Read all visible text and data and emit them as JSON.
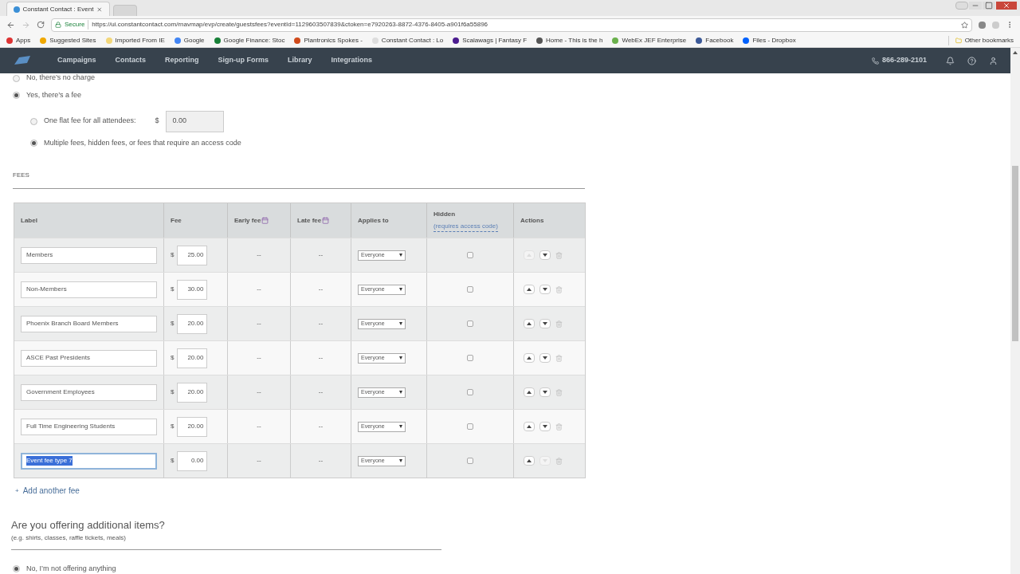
{
  "browser": {
    "tabs": [
      {
        "title": "Constant Contact : Event",
        "selected": true
      },
      {
        "selected": false
      }
    ],
    "url_secure": "Secure",
    "url": "https://ui.constantcontact.com/rnavmap/evp/create/guestsfees?eventId=1129603507839&ctoken=e7920263-8872-4376-8405-a901f6a55896",
    "bookmarks": [
      "Apps",
      "Suggested Sites",
      "Imported From IE",
      "Google",
      "Google Finance: Stoc",
      "Plantronics Spokes -",
      "Constant Contact : Lo",
      "Scalawags | Fantasy F",
      "Home - This is the h",
      "WebEx JEF Enterprise",
      "Facebook",
      "Files - Dropbox"
    ],
    "other_bookmarks": "Other bookmarks"
  },
  "nav": {
    "items": [
      "Campaigns",
      "Contacts",
      "Reporting",
      "Sign-up Forms",
      "Library",
      "Integrations"
    ],
    "phone": "866-289-2101"
  },
  "charge_options": [
    {
      "label": "No, there’s no charge",
      "selected": false
    },
    {
      "label": "Yes, there’s a fee",
      "selected": true
    }
  ],
  "fee_options": [
    {
      "label": "One flat fee for all attendees:",
      "selected": false,
      "currency": "$",
      "value": "0.00"
    },
    {
      "label": "Multiple fees, hidden fees, or fees that require an access code",
      "selected": true
    }
  ],
  "fees_heading": "FEES",
  "columns": {
    "label": "Label",
    "fee": "Fee",
    "early_fee": "Early fee",
    "late_fee": "Late fee",
    "applies_to": "Applies to",
    "hidden": "Hidden",
    "hidden_note": "(requires access code)",
    "actions": "Actions"
  },
  "rows": [
    {
      "label": "Members",
      "currency": "$",
      "fee": "25.00",
      "early": "--",
      "late": "--",
      "applies": "Everyone",
      "hidden": false,
      "up_disabled": true,
      "down_disabled": false,
      "focused": false
    },
    {
      "label": "Non-Members",
      "currency": "$",
      "fee": "30.00",
      "early": "--",
      "late": "--",
      "applies": "Everyone",
      "hidden": false,
      "up_disabled": false,
      "down_disabled": false,
      "focused": false
    },
    {
      "label": "Phoenix Branch Board Members",
      "currency": "$",
      "fee": "20.00",
      "early": "--",
      "late": "--",
      "applies": "Everyone",
      "hidden": false,
      "up_disabled": false,
      "down_disabled": false,
      "focused": false
    },
    {
      "label": "ASCE Past Presidents",
      "currency": "$",
      "fee": "20.00",
      "early": "--",
      "late": "--",
      "applies": "Everyone",
      "hidden": false,
      "up_disabled": false,
      "down_disabled": false,
      "focused": false
    },
    {
      "label": "Government Employees",
      "currency": "$",
      "fee": "20.00",
      "early": "--",
      "late": "--",
      "applies": "Everyone",
      "hidden": false,
      "up_disabled": false,
      "down_disabled": false,
      "focused": false
    },
    {
      "label": "Full Time Engineering Students",
      "currency": "$",
      "fee": "20.00",
      "early": "--",
      "late": "--",
      "applies": "Everyone",
      "hidden": false,
      "up_disabled": false,
      "down_disabled": false,
      "focused": false
    },
    {
      "label": "Event fee type 7",
      "currency": "$",
      "fee": "0.00",
      "early": "--",
      "late": "--",
      "applies": "Everyone",
      "hidden": false,
      "up_disabled": false,
      "down_disabled": true,
      "focused": true
    }
  ],
  "add_fee": {
    "icon": "+",
    "label": "Add another fee"
  },
  "additional": {
    "heading": "Are you offering additional items?",
    "hint": "(e.g. shirts, classes, raffle tickets, meals)",
    "options": [
      {
        "label": "No, I’m not offering anything",
        "selected": true
      }
    ]
  }
}
